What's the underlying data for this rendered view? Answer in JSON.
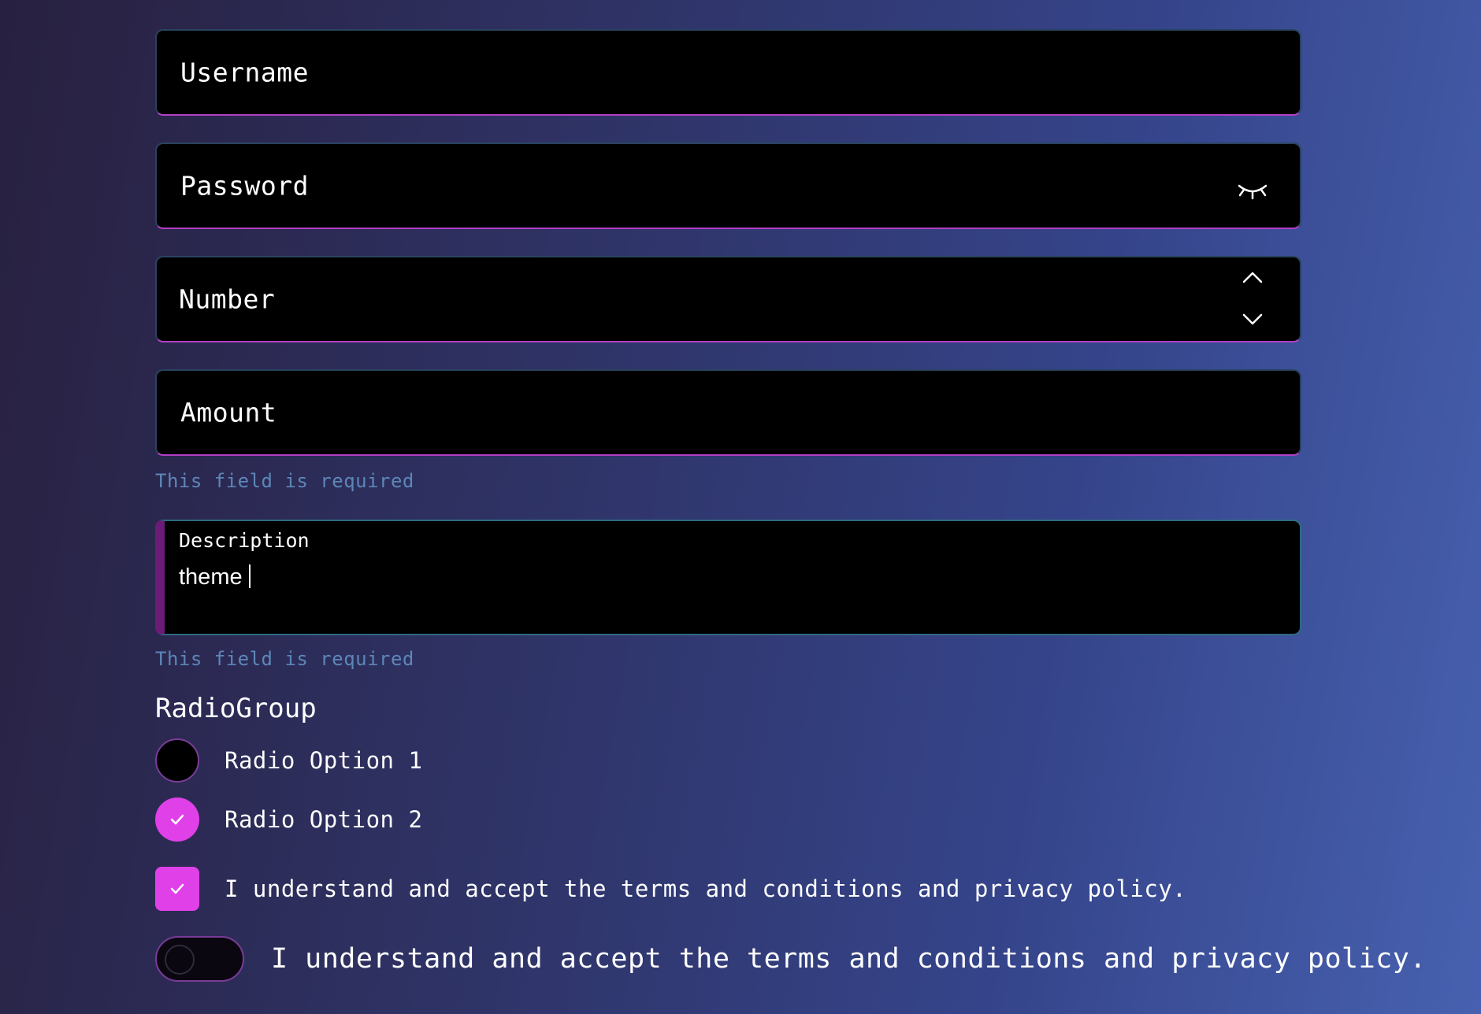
{
  "fields": {
    "username": {
      "label": "Username"
    },
    "password": {
      "label": "Password",
      "icon": "eye-closed-icon"
    },
    "number": {
      "label": "Number",
      "icons": [
        "chevron-up-icon",
        "chevron-down-icon"
      ]
    },
    "amount": {
      "label": "Amount",
      "error": "This field is required"
    }
  },
  "description": {
    "label": "Description",
    "value": "theme",
    "error": "This field is required"
  },
  "radio_group": {
    "title": "RadioGroup",
    "options": [
      {
        "label": "Radio Option 1",
        "selected": false
      },
      {
        "label": "Radio Option 2",
        "selected": true
      }
    ]
  },
  "terms_checkbox": {
    "label": "I understand and accept the terms and conditions and privacy policy.",
    "checked": true
  },
  "terms_toggle": {
    "label": "I understand and accept the terms and conditions and privacy policy.",
    "on": false
  },
  "colors": {
    "accent": "#e040e8",
    "error_text": "#5d86b8",
    "field_bg": "#000000"
  }
}
